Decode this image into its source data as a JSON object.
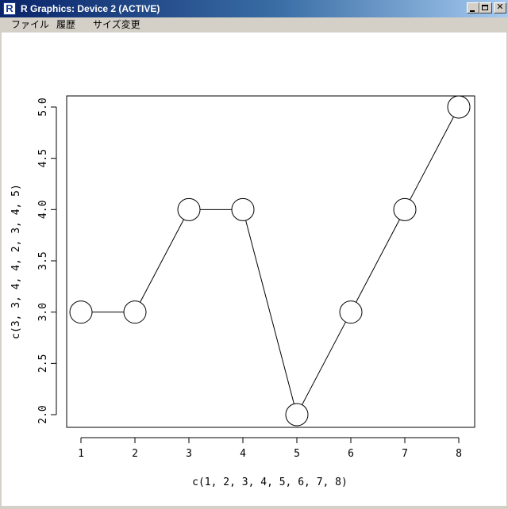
{
  "window": {
    "title": "R Graphics: Device 2 (ACTIVE)",
    "icon_letter": "R",
    "buttons": {
      "minimize": "minimize-icon",
      "maximize": "maximize-icon",
      "close": "close-icon"
    }
  },
  "menu": {
    "items": [
      "ファイル",
      "履歴",
      "サイズ変更"
    ]
  },
  "chart_data": {
    "type": "line",
    "title": "",
    "xlabel": "c(1, 2, 3, 4, 5, 6, 7, 8)",
    "ylabel": "c(3, 3, 4, 4, 2, 3, 4, 5)",
    "x": [
      1,
      2,
      3,
      4,
      5,
      6,
      7,
      8
    ],
    "y": [
      3,
      3,
      4,
      4,
      2,
      3,
      4,
      5
    ],
    "xlim": [
      1,
      8
    ],
    "ylim": [
      2,
      5
    ],
    "xticks": [
      "1",
      "2",
      "3",
      "4",
      "5",
      "6",
      "7",
      "8"
    ],
    "yticks": [
      "2.0",
      "2.5",
      "3.0",
      "3.5",
      "4.0",
      "4.5",
      "5.0"
    ],
    "marker": "open-circle",
    "grid": false,
    "line_color": "#000000"
  }
}
